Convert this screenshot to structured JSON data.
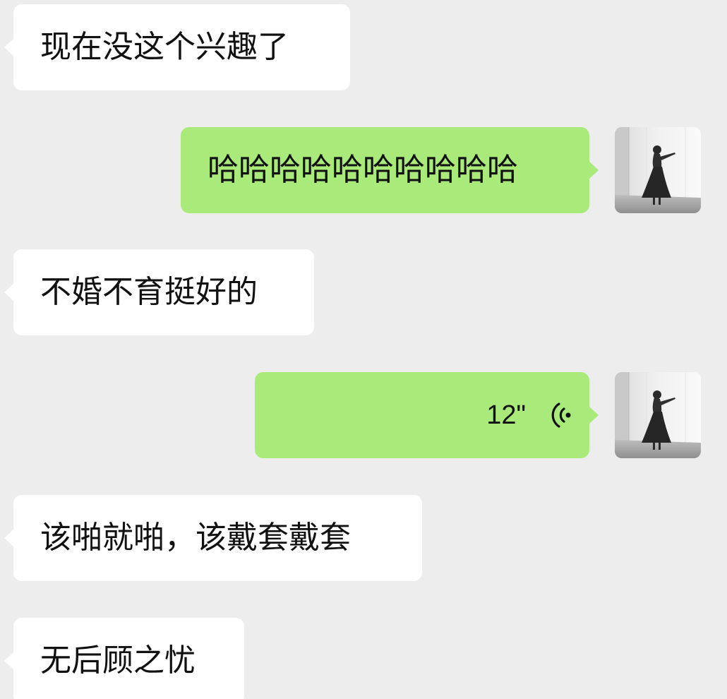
{
  "messages": [
    {
      "sender": "other",
      "text": "现在没这个兴趣了"
    },
    {
      "sender": "me",
      "text": "哈哈哈哈哈哈哈哈哈哈"
    },
    {
      "sender": "other",
      "text": "不婚不育挺好的"
    },
    {
      "sender": "me",
      "type": "voice",
      "duration": "12\""
    },
    {
      "sender": "other",
      "text": "该啪就啪，该戴套戴套"
    },
    {
      "sender": "other",
      "text": "无后顾之忧"
    }
  ],
  "colors": {
    "background": "#ededed",
    "incoming_bubble": "#ffffff",
    "outgoing_bubble": "#a9ea7a"
  },
  "icons": {
    "voice": "voice-wave-icon",
    "avatar": "user-avatar-photo"
  }
}
